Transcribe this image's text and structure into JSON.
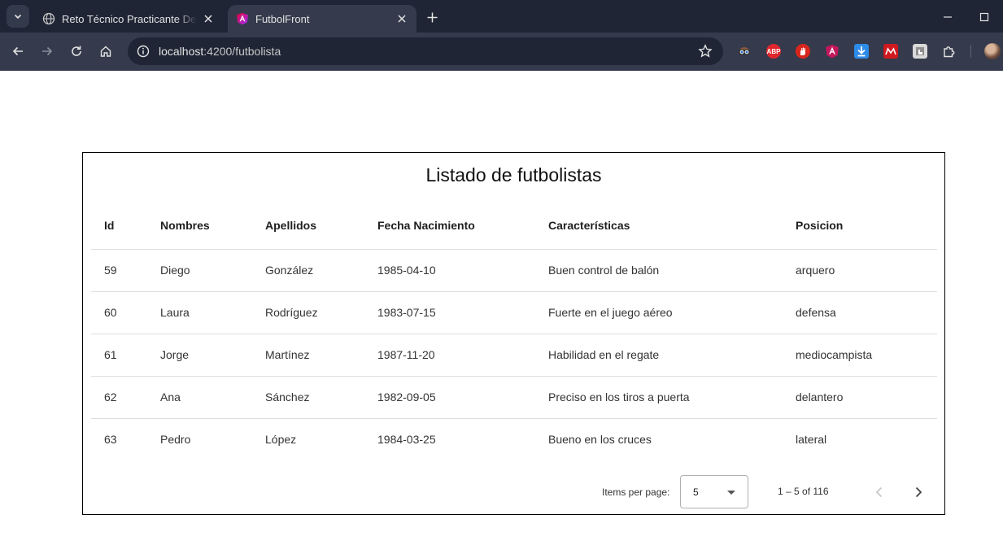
{
  "browser": {
    "tabs": [
      {
        "title": "Reto Técnico Practicante Desarrollador",
        "active": false
      },
      {
        "title": "FutbolFront",
        "active": true
      }
    ],
    "url": {
      "host": "localhost",
      "path": ":4200/futbolista"
    },
    "extensions": [
      {
        "icon": "spy-glasses-icon",
        "color": "#2a2f3d"
      },
      {
        "icon": "adblock-plus-icon",
        "label": "ABP",
        "color": "#e0262d"
      },
      {
        "icon": "stop-hand-icon",
        "color": "#d9261c"
      },
      {
        "icon": "angular-devtools-icon",
        "color": "#c2185b"
      },
      {
        "icon": "download-arrow-icon",
        "color": "#2d8be8"
      },
      {
        "icon": "mendeley-icon",
        "color": "#d0191f"
      },
      {
        "icon": "touch-extension-icon",
        "color": "#d9d9d9"
      },
      {
        "icon": "puzzle-extensions-icon",
        "color": "#353b4c"
      }
    ]
  },
  "page": {
    "title": "Listado de futbolistas",
    "table": {
      "headers": [
        "Id",
        "Nombres",
        "Apellidos",
        "Fecha Nacimiento",
        "Características",
        "Posicion"
      ],
      "rows": [
        [
          "59",
          "Diego",
          "González",
          "1985-04-10",
          "Buen control de balón",
          "arquero"
        ],
        [
          "60",
          "Laura",
          "Rodríguez",
          "1983-07-15",
          "Fuerte en el juego aéreo",
          "defensa"
        ],
        [
          "61",
          "Jorge",
          "Martínez",
          "1987-11-20",
          "Habilidad en el regate",
          "mediocampista"
        ],
        [
          "62",
          "Ana",
          "Sánchez",
          "1982-09-05",
          "Preciso en los tiros a puerta",
          "delantero"
        ],
        [
          "63",
          "Pedro",
          "López",
          "1984-03-25",
          "Bueno en los cruces",
          "lateral"
        ]
      ]
    },
    "paginator": {
      "items_per_page_label": "Items per page:",
      "items_per_page_value": "5",
      "range_label": "1 – 5 of 116"
    }
  }
}
